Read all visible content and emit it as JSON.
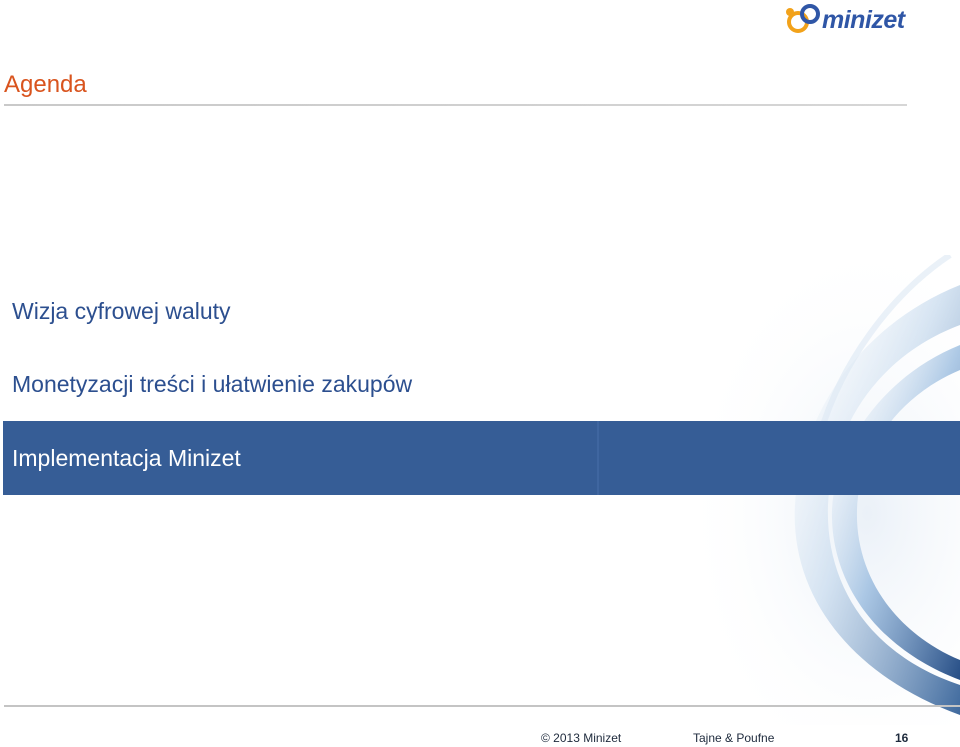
{
  "header": {
    "logo_text": "minizet"
  },
  "slide": {
    "title": "Agenda",
    "items": [
      {
        "label": "Wizja cyfrowej waluty"
      },
      {
        "label": "Monetyzacji treści i ułatwienie zakupów"
      },
      {
        "label": "Implementacja Minizet"
      }
    ],
    "highlighted_index": 2
  },
  "footer": {
    "copyright": "© 2013 Minizet",
    "confidentiality": "Tajne & Poufne",
    "page_number": "16"
  },
  "colors": {
    "title": "#d9541e",
    "item_text": "#2c4f8f",
    "highlight_bar": "#365d96",
    "logo_blue": "#2f56a6",
    "logo_orange": "#f2a21a"
  }
}
